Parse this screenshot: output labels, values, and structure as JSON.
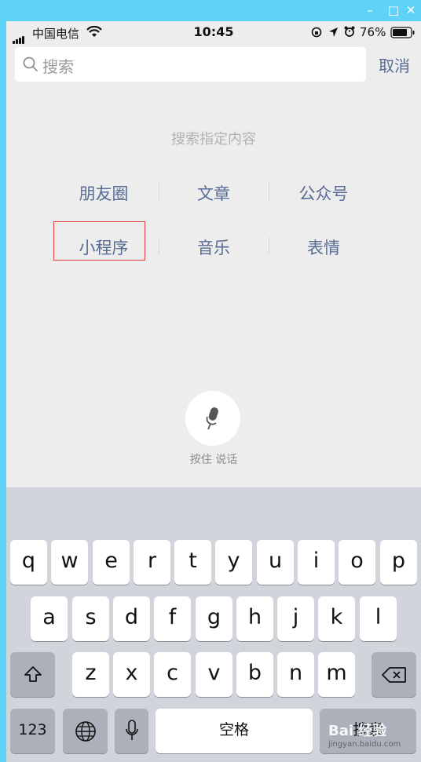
{
  "window": {
    "minimize": "–",
    "maximize": "□",
    "close": "✕"
  },
  "status_bar": {
    "carrier": "中国电信",
    "time": "10:45",
    "battery_percent": "76%"
  },
  "search": {
    "placeholder": "搜索",
    "cancel_label": "取消"
  },
  "hint": "搜索指定内容",
  "categories": [
    {
      "label": "朋友圈"
    },
    {
      "label": "文章"
    },
    {
      "label": "公众号"
    },
    {
      "label": "小程序"
    },
    {
      "label": "音乐"
    },
    {
      "label": "表情"
    }
  ],
  "voice": {
    "label": "按住 说话"
  },
  "keyboard": {
    "row1": [
      "q",
      "w",
      "e",
      "r",
      "t",
      "y",
      "u",
      "i",
      "o",
      "p"
    ],
    "row2": [
      "a",
      "s",
      "d",
      "f",
      "g",
      "h",
      "j",
      "k",
      "l"
    ],
    "row3": [
      "z",
      "x",
      "c",
      "v",
      "b",
      "n",
      "m"
    ],
    "numbers_label": "123",
    "space_label": "空格",
    "search_label": "搜索"
  },
  "watermark": {
    "text": "Bai  经验",
    "sub": "jingyan.baidu.com"
  },
  "colors": {
    "link": "#576b95",
    "highlight_box": "#e23b3b",
    "title_bar": "#5fd3f7"
  }
}
